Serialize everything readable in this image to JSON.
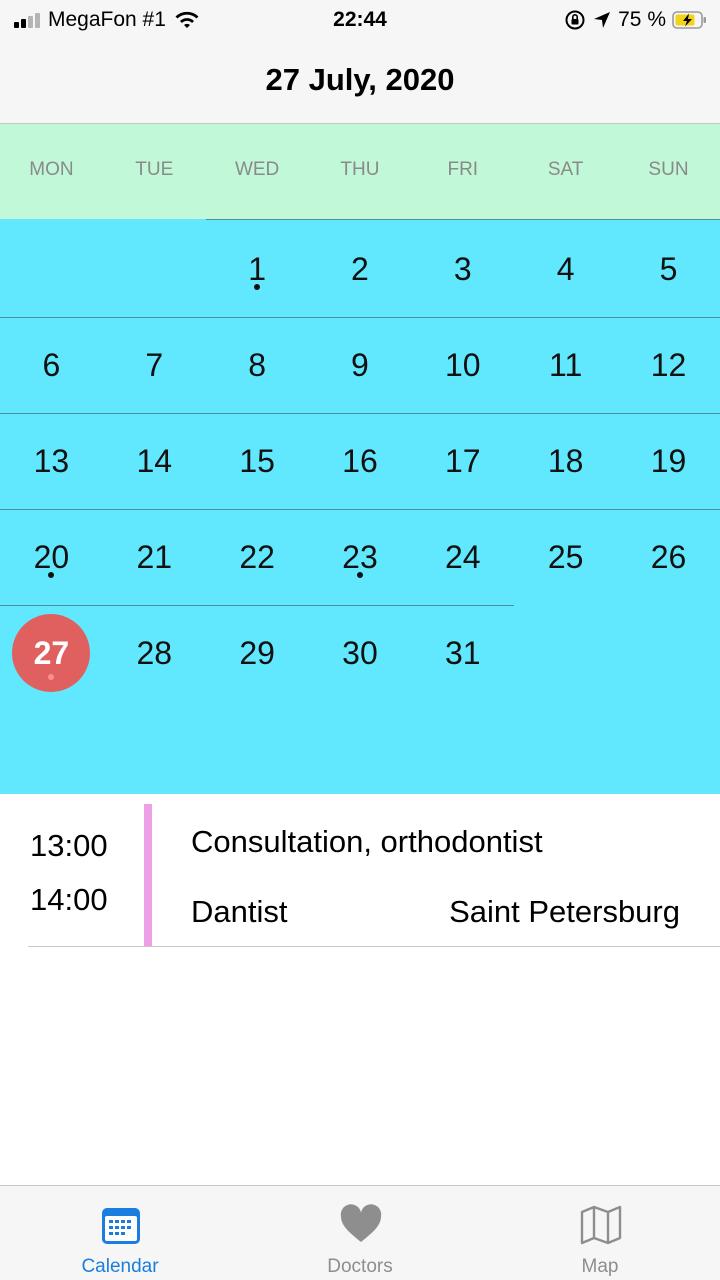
{
  "status_bar": {
    "carrier": "MegaFon #1",
    "time": "22:44",
    "battery_percent": "75 %"
  },
  "header": {
    "title": "27 July, 2020"
  },
  "calendar": {
    "weekdays": [
      "MON",
      "TUE",
      "WED",
      "THU",
      "FRI",
      "SAT",
      "SUN"
    ],
    "weeks": [
      [
        null,
        null,
        "1",
        "2",
        "3",
        "4",
        "5"
      ],
      [
        "6",
        "7",
        "8",
        "9",
        "10",
        "11",
        "12"
      ],
      [
        "13",
        "14",
        "15",
        "16",
        "17",
        "18",
        "19"
      ],
      [
        "20",
        "21",
        "22",
        "23",
        "24",
        "25",
        "26"
      ],
      [
        "27",
        "28",
        "29",
        "30",
        "31",
        null,
        null
      ]
    ],
    "event_days": [
      "1",
      "20",
      "23",
      "27"
    ],
    "selected_day": "27",
    "colors": {
      "weekday_bg": "#c0f8d8",
      "grid_bg": "#61e8ff",
      "today": "#e06060"
    }
  },
  "event": {
    "start_time": "13:00",
    "end_time": "14:00",
    "title": "Consultation, orthodontist",
    "doctor": "Dantist",
    "location": "Saint Petersburg",
    "accent_color": "#eea0e6"
  },
  "tabbar": {
    "tabs": [
      {
        "label": "Calendar",
        "icon": "calendar-icon",
        "active": true
      },
      {
        "label": "Doctors",
        "icon": "heart-icon",
        "active": false
      },
      {
        "label": "Map",
        "icon": "map-icon",
        "active": false
      }
    ],
    "active_color": "#1a7ee0"
  }
}
